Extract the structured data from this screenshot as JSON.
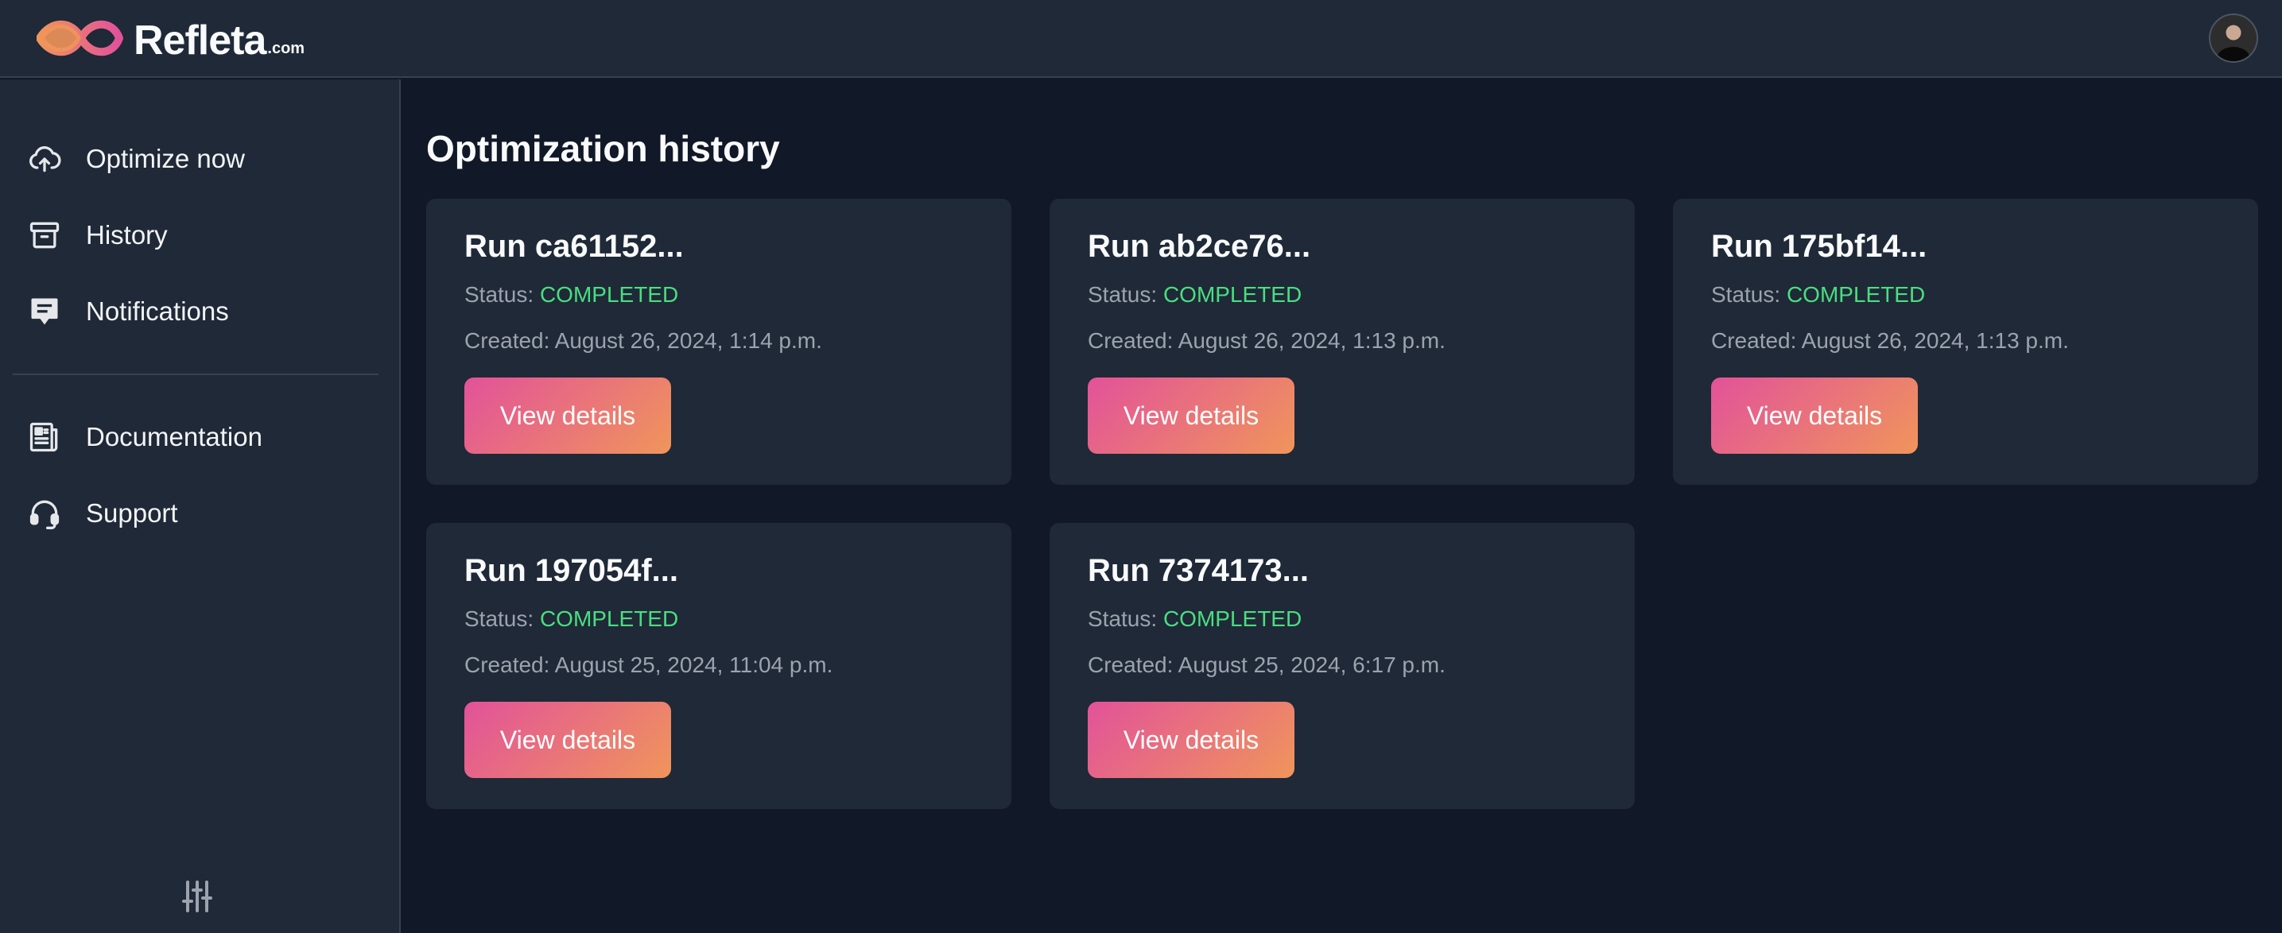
{
  "brand": {
    "name": "Refleta",
    "tld": ".com",
    "colors": {
      "pink": "#e2529a",
      "orange": "#f0955b"
    }
  },
  "header": {
    "avatar_icon": "user-avatar"
  },
  "sidebar": {
    "primary": [
      {
        "label": "Optimize now",
        "icon": "cloud-upload-icon"
      },
      {
        "label": "History",
        "icon": "archive-box-icon"
      },
      {
        "label": "Notifications",
        "icon": "chat-alert-icon"
      }
    ],
    "secondary": [
      {
        "label": "Documentation",
        "icon": "document-icon"
      },
      {
        "label": "Support",
        "icon": "headset-icon"
      }
    ],
    "settings_icon": "sliders-icon"
  },
  "main": {
    "title": "Optimization history",
    "status_label": "Status:",
    "created_label": "Created:",
    "button_label": "View details",
    "status_color": "#4ade80",
    "runs": [
      {
        "title": "Run ca61152...",
        "status": "COMPLETED",
        "created": "August 26, 2024, 1:14 p.m."
      },
      {
        "title": "Run ab2ce76...",
        "status": "COMPLETED",
        "created": "August 26, 2024, 1:13 p.m."
      },
      {
        "title": "Run 175bf14...",
        "status": "COMPLETED",
        "created": "August 26, 2024, 1:13 p.m."
      },
      {
        "title": "Run 197054f...",
        "status": "COMPLETED",
        "created": "August 25, 2024, 11:04 p.m."
      },
      {
        "title": "Run 7374173...",
        "status": "COMPLETED",
        "created": "August 25, 2024, 6:17 p.m."
      }
    ]
  }
}
